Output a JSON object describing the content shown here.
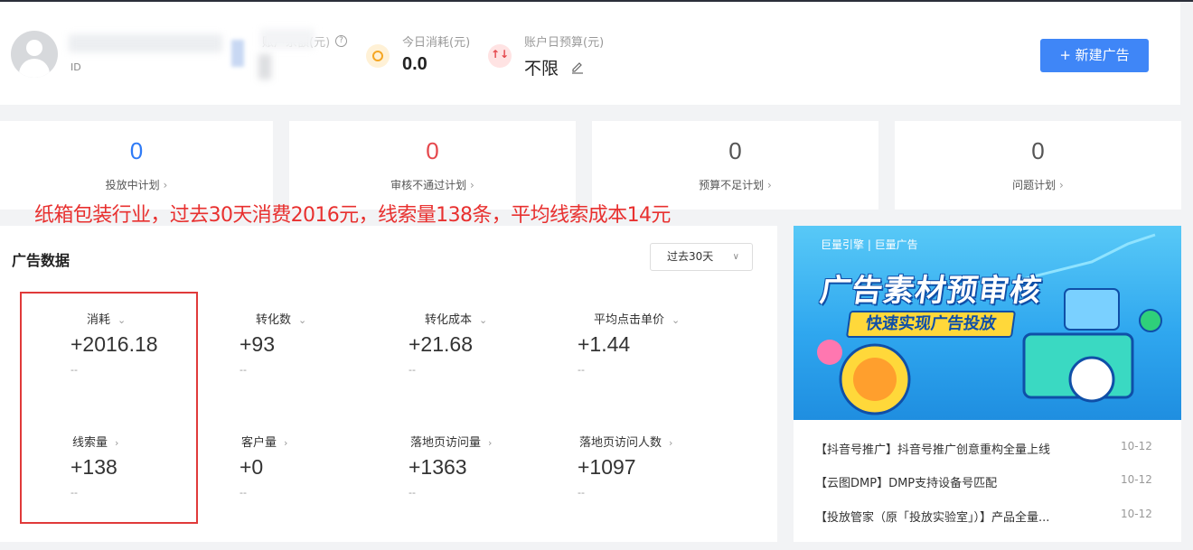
{
  "header": {
    "id_label": "ID",
    "balance_label": "账户余额(元)",
    "today_spend": {
      "label": "今日消耗(元)",
      "value": "0.0"
    },
    "daily_budget": {
      "label": "账户日预算(元)",
      "value": "不限"
    },
    "new_ad_button": "+ 新建广告"
  },
  "plans": [
    {
      "count": "0",
      "label": "投放中计划",
      "color": "#2f7bf6"
    },
    {
      "count": "0",
      "label": "审核不通过计划",
      "color": "#e5484d"
    },
    {
      "count": "0",
      "label": "预算不足计划",
      "color": "#555555"
    },
    {
      "count": "0",
      "label": "问题计划",
      "color": "#555555"
    }
  ],
  "annotation": "纸箱包装行业，过去30天消费2016元，线索量138条，平均线索成本14元",
  "ad_data": {
    "title": "广告数据",
    "range": "过去30天",
    "metrics": [
      {
        "label": "消耗",
        "arrow": "⌄",
        "value": "+2016.18",
        "sub": "--"
      },
      {
        "label": "转化数",
        "arrow": "⌄",
        "value": "+93",
        "sub": "--"
      },
      {
        "label": "转化成本",
        "arrow": "⌄",
        "value": "+21.68",
        "sub": "--"
      },
      {
        "label": "平均点击单价",
        "arrow": "⌄",
        "value": "+1.44",
        "sub": "--"
      },
      {
        "label": "线索量",
        "arrow": "›",
        "value": "+138",
        "sub": "--"
      },
      {
        "label": "客户量",
        "arrow": "›",
        "value": "+0",
        "sub": "--"
      },
      {
        "label": "落地页访问量",
        "arrow": "›",
        "value": "+1363",
        "sub": "--"
      },
      {
        "label": "落地页访问人数",
        "arrow": "›",
        "value": "+1097",
        "sub": "--"
      }
    ]
  },
  "promo": {
    "brand": "巨量引擎 | 巨量广告",
    "title": "广告素材预审核",
    "subtitle": "快速实现广告投放",
    "news": [
      {
        "title": "【抖音号推广】抖音号推广创意重构全量上线",
        "date": "10-12"
      },
      {
        "title": "【云图DMP】DMP支持设备号匹配",
        "date": "10-12"
      },
      {
        "title": "【投放管家（原「投放实验室」）】产品全量...",
        "date": "10-12"
      }
    ]
  },
  "colors": {
    "accent": "#3f86f7",
    "annotation": "#e8302f"
  }
}
